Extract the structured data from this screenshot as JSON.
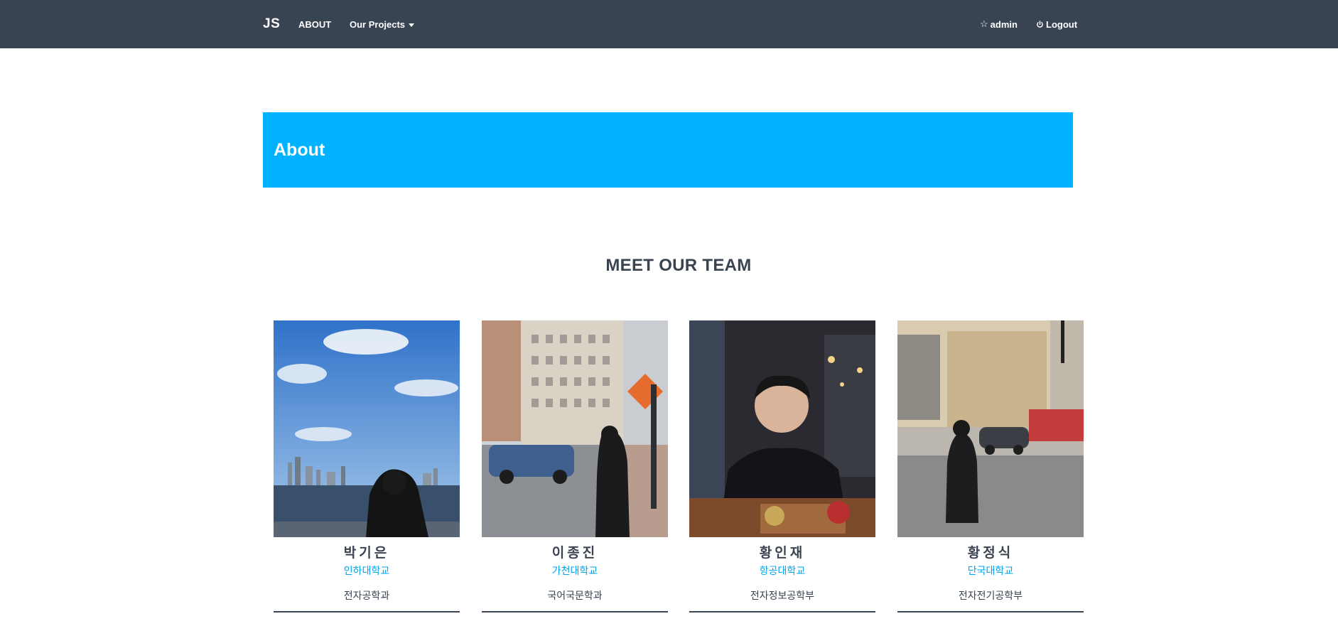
{
  "navbar": {
    "brand": "JS",
    "about": "ABOUT",
    "projects": "Our Projects",
    "admin": "admin",
    "logout": "Logout",
    "background": "#394453"
  },
  "banner": {
    "title": "About",
    "color": "#00b2ff"
  },
  "team": {
    "heading": "MEET OUR TEAM",
    "members": [
      {
        "name": "박기은",
        "school": "인하대학교",
        "dept": "전자공학과"
      },
      {
        "name": "이종진",
        "school": "가천대학교",
        "dept": "국어국문학과"
      },
      {
        "name": "황인재",
        "school": "항공대학교",
        "dept": "전자정보공학부"
      },
      {
        "name": "황정식",
        "school": "단국대학교",
        "dept": "전자전기공학부"
      }
    ]
  }
}
